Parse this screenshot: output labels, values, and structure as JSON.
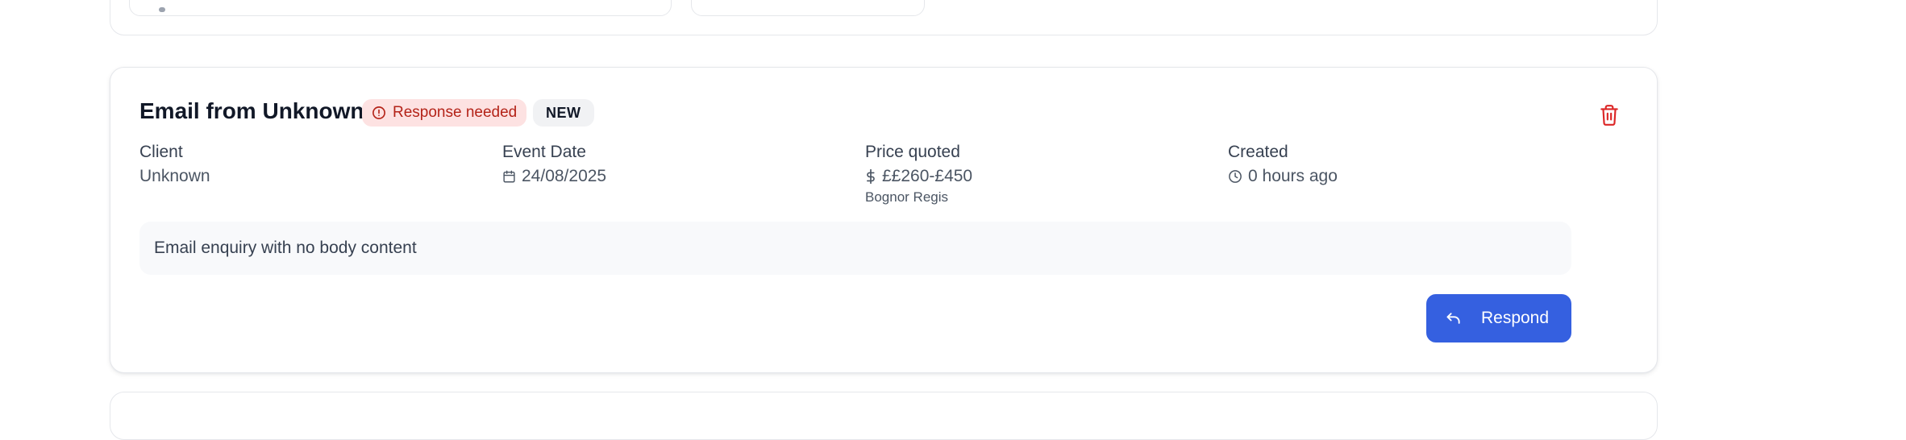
{
  "card": {
    "title": "Email from Unknown",
    "badges": {
      "response_needed": "Response needed",
      "new": "NEW"
    },
    "fields": {
      "client": {
        "label": "Client",
        "value": "Unknown"
      },
      "event_date": {
        "label": "Event Date",
        "value": "24/08/2025",
        "icon": "calendar-icon"
      },
      "price": {
        "label": "Price quoted",
        "value": "££260-£450",
        "sub": "Bognor Regis",
        "icon": "dollar-icon"
      },
      "created": {
        "label": "Created",
        "value": "0 hours ago",
        "icon": "clock-icon"
      }
    },
    "message": "Email enquiry with no body content",
    "respond_label": "Respond",
    "delete_icon": "trash-icon"
  },
  "colors": {
    "accent": "#3560e0",
    "danger": "#dc2626",
    "badge_danger_bg": "#fde2e2",
    "badge_danger_text": "#b42318",
    "badge_neutral_bg": "#f1f2f4"
  }
}
